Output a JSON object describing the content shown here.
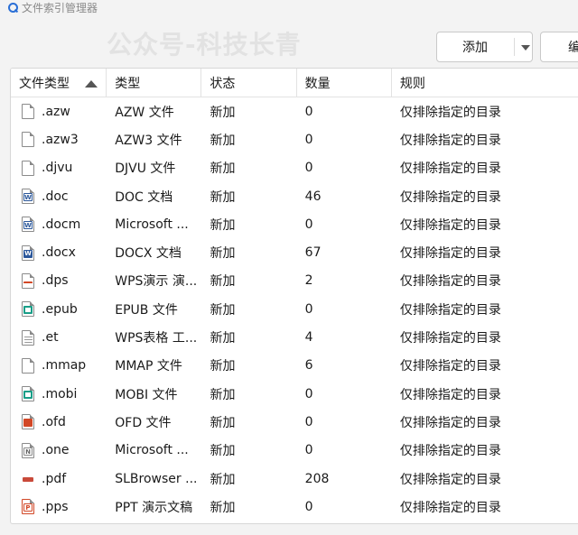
{
  "window": {
    "title": "文件索引管理器",
    "icon": "search-icon"
  },
  "watermark": "公众号-科技长青",
  "toolbar": {
    "add_label": "添加",
    "edit_label": "编"
  },
  "table": {
    "columns": [
      "文件类型",
      "类型",
      "状态",
      "数量",
      "规则"
    ],
    "sort": {
      "column": "文件类型",
      "direction": "ascending"
    },
    "rows": [
      {
        "icon": "blank-file-icon",
        "ext": ".azw",
        "type": "AZW 文件",
        "status": "新加",
        "count": "0",
        "rule": "仅排除指定的目录"
      },
      {
        "icon": "blank-file-icon",
        "ext": ".azw3",
        "type": "AZW3 文件",
        "status": "新加",
        "count": "0",
        "rule": "仅排除指定的目录"
      },
      {
        "icon": "blank-file-icon",
        "ext": ".djvu",
        "type": "DJVU 文件",
        "status": "新加",
        "count": "0",
        "rule": "仅排除指定的目录"
      },
      {
        "icon": "word-doc-icon",
        "ext": ".doc",
        "type": "DOC 文档",
        "status": "新加",
        "count": "46",
        "rule": "仅排除指定的目录"
      },
      {
        "icon": "word-doc-icon",
        "ext": ".docm",
        "type": "Microsoft ...",
        "status": "新加",
        "count": "0",
        "rule": "仅排除指定的目录"
      },
      {
        "icon": "word-docx-icon",
        "ext": ".docx",
        "type": "DOCX 文档",
        "status": "新加",
        "count": "67",
        "rule": "仅排除指定的目录"
      },
      {
        "icon": "wps-presentation-icon",
        "ext": ".dps",
        "type": "WPS演示 演...",
        "status": "新加",
        "count": "2",
        "rule": "仅排除指定的目录"
      },
      {
        "icon": "ebook-icon",
        "ext": ".epub",
        "type": "EPUB 文件",
        "status": "新加",
        "count": "0",
        "rule": "仅排除指定的目录"
      },
      {
        "icon": "spreadsheet-icon",
        "ext": ".et",
        "type": "WPS表格 工...",
        "status": "新加",
        "count": "4",
        "rule": "仅排除指定的目录"
      },
      {
        "icon": "blank-file-icon",
        "ext": ".mmap",
        "type": "MMAP 文件",
        "status": "新加",
        "count": "6",
        "rule": "仅排除指定的目录"
      },
      {
        "icon": "ebook-icon",
        "ext": ".mobi",
        "type": "MOBI 文件",
        "status": "新加",
        "count": "0",
        "rule": "仅排除指定的目录"
      },
      {
        "icon": "ofd-file-icon",
        "ext": ".ofd",
        "type": "OFD 文件",
        "status": "新加",
        "count": "0",
        "rule": "仅排除指定的目录"
      },
      {
        "icon": "onenote-icon",
        "ext": ".one",
        "type": "Microsoft ...",
        "status": "新加",
        "count": "0",
        "rule": "仅排除指定的目录"
      },
      {
        "icon": "pdf-icon",
        "ext": ".pdf",
        "type": "SLBrowser ...",
        "status": "新加",
        "count": "208",
        "rule": "仅排除指定的目录"
      },
      {
        "icon": "powerpoint-icon",
        "ext": ".pps",
        "type": "PPT 演示文稿",
        "status": "新加",
        "count": "0",
        "rule": "仅排除指定的目录"
      }
    ]
  }
}
